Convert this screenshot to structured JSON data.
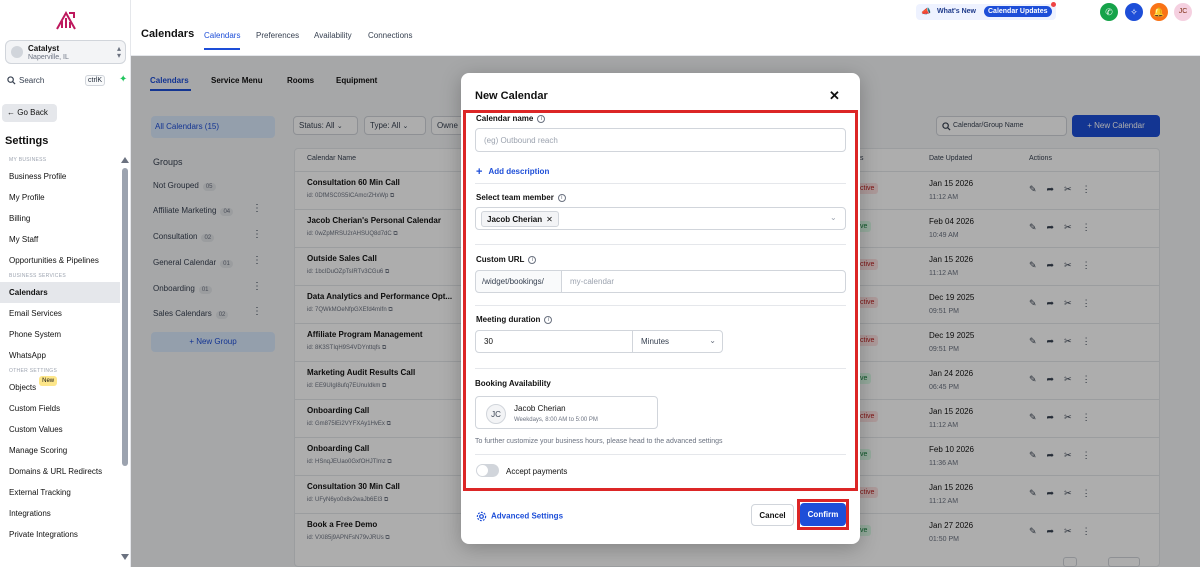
{
  "sidebar": {
    "location_name": "Catalyst",
    "location_city": "Naperville, IL",
    "search_label": "Search",
    "search_shortcut": "ctrlK",
    "go_back": "← Go Back",
    "settings_title": "Settings",
    "sections": [
      {
        "title": "MY BUSINESS",
        "items": [
          "Business Profile",
          "My Profile",
          "Billing",
          "My Staff",
          "Opportunities & Pipelines"
        ]
      },
      {
        "title": "BUSINESS SERVICES",
        "items": [
          "Calendars",
          "Email Services",
          "Phone System",
          "WhatsApp"
        ]
      },
      {
        "title": "OTHER SETTINGS",
        "items": [
          "Objects",
          "Custom Fields",
          "Custom Values",
          "Manage Scoring",
          "Domains & URL Redirects",
          "External Tracking",
          "Integrations",
          "Private Integrations"
        ]
      }
    ],
    "active_item": "Calendars",
    "objects_badge": "New"
  },
  "topbar": {
    "title": "Calendars",
    "tabs": [
      "Calendars",
      "Preferences",
      "Availability",
      "Connections"
    ],
    "active_tab": "Calendars",
    "whats_new": "What's New",
    "updates_badge": "Calendar Updates",
    "avatar_initials": "JC"
  },
  "subtabs": [
    "Calendars",
    "Service Menu",
    "Rooms",
    "Equipment"
  ],
  "groups": {
    "all_calendars": "All Calendars (15)",
    "heading": "Groups",
    "items": [
      {
        "name": "Not Grouped",
        "count": "05"
      },
      {
        "name": "Affiliate Marketing",
        "count": "04"
      },
      {
        "name": "Consultation",
        "count": "02"
      },
      {
        "name": "General Calendar",
        "count": "01"
      },
      {
        "name": "Onboarding",
        "count": "01"
      },
      {
        "name": "Sales Calendars",
        "count": "02"
      }
    ],
    "new_group": "+ New Group"
  },
  "filters": {
    "status": "Status: All",
    "type": "Type: All",
    "owner": "Owne"
  },
  "search_placeholder": "Calendar/Group Name",
  "new_calendar": "+ New Calendar",
  "table": {
    "headers": [
      "Calendar Name",
      "s",
      "Date Updated",
      "Actions"
    ],
    "rows": [
      {
        "name": "Consultation 60 Min Call",
        "id": "id: 0DfMSC0S5ICAmcrZHxWp",
        "status": "ctive",
        "date": "Jan 15 2026",
        "time": "11:12 AM"
      },
      {
        "name": "Jacob Cherian's Personal Calendar",
        "id": "id: 0wZpMRSU2rAHSUQ8d7dC",
        "status": "ve",
        "date": "Feb 04 2026",
        "time": "10:49 AM"
      },
      {
        "name": "Outside Sales Call",
        "id": "id: 1bcIDuOZpTsIRTv3CGu6",
        "status": "ctive",
        "date": "Jan 15 2026",
        "time": "11:12 AM"
      },
      {
        "name": "Data Analytics and Performance Opt...",
        "id": "id: 7QWkMOeNfpGXEfd4mIfn",
        "status": "ctive",
        "date": "Dec 19 2025",
        "time": "09:51 PM"
      },
      {
        "name": "Affiliate Program Management",
        "id": "id: 8K3STIqH9S4VDYnttqfs",
        "status": "ctive",
        "date": "Dec 19 2025",
        "time": "09:51 PM"
      },
      {
        "name": "Marketing Audit Results Call",
        "id": "id: EE9UIgI8ufq7EUnuIdkm",
        "status": "ve",
        "date": "Jan 24 2026",
        "time": "06:45 PM"
      },
      {
        "name": "Onboarding Call",
        "id": "id: Gm875lEi2VYFXAy1HvEx",
        "status": "ctive",
        "date": "Jan 15 2026",
        "time": "11:12 AM"
      },
      {
        "name": "Onboarding Call",
        "id": "id: HSnqJEUao0GxfOHJTlmz",
        "status": "ve",
        "date": "Feb 10 2026",
        "time": "11:36 AM"
      },
      {
        "name": "Consultation 30 Min Call",
        "id": "id: UFyN6yo0x8v2waJb6EI3",
        "status": "ctive",
        "date": "Jan 15 2026",
        "time": "11:12 AM"
      },
      {
        "name": "Book a Free Demo",
        "id": "id: VXI85j9APNFsN79vJRUs",
        "status": "ve",
        "date": "Jan 27 2026",
        "time": "01:50 PM"
      }
    ]
  },
  "modal": {
    "title": "New Calendar",
    "calendar_name_label": "Calendar name",
    "calendar_name_placeholder": "(eg) Outbound reach",
    "add_description": "Add description",
    "team_member_label": "Select team member",
    "team_member_chip": "Jacob Cherian",
    "custom_url_label": "Custom URL",
    "url_prefix": "/widget/bookings/",
    "url_placeholder": "my-calendar",
    "meeting_duration_label": "Meeting duration",
    "duration_value": "30",
    "duration_unit": "Minutes",
    "booking_availability_label": "Booking Availability",
    "availability_initials": "JC",
    "availability_name": "Jacob Cherian",
    "availability_schedule": "Weekdays, 8:00 AM to 5:00 PM",
    "availability_note": "To further customize your business hours, please head to the advanced settings",
    "accept_payments": "Accept payments",
    "advanced_settings": "Advanced Settings",
    "cancel": "Cancel",
    "confirm": "Confirm"
  },
  "colors": {
    "accent": "#1d4ed8",
    "highlight": "#dc2626",
    "inactive_badge": "#fee2e2",
    "active_badge": "#dcfce7"
  }
}
